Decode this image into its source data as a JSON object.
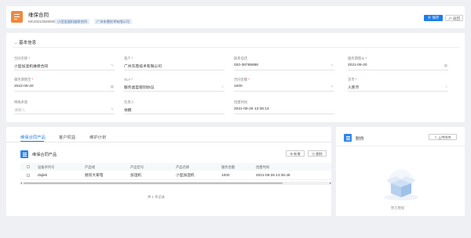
{
  "header": {
    "title": "维保合同",
    "code": "MC202109260001",
    "tags": [
      "小型加湿机维保合同",
      "广州东鼎技术有限公司"
    ],
    "save_label": "保存",
    "back_label": "返回"
  },
  "basic_info": {
    "section_title": "基本信息",
    "fields": [
      {
        "label": "合同名称",
        "required": true,
        "value": "小型加湿机维保合同",
        "icon": "edit-icon"
      },
      {
        "label": "客户",
        "required": true,
        "value": "广州东鼎技术有限公司",
        "icon": ""
      },
      {
        "label": "联系电话",
        "required": false,
        "value": "020-38788698",
        "icon": "edit-icon"
      },
      {
        "label": "服务期限从",
        "required": true,
        "value": "2021-09-20",
        "icon": "calendar-icon"
      },
      {
        "label": "服务期限至",
        "required": true,
        "value": "2022-09-20",
        "icon": "calendar-icon"
      },
      {
        "label": "SLA",
        "required": true,
        "value": "服务类型级别协议",
        "icon": "search-icon"
      },
      {
        "label": "合同金额",
        "required": true,
        "value": "1000",
        "icon": "edit-icon"
      },
      {
        "label": "货币",
        "required": true,
        "value": "人民币",
        "icon": "search-icon"
      },
      {
        "label": "特殊条款",
        "required": false,
        "value": "请输入",
        "icon": "edit-icon",
        "placeholder": true
      },
      {
        "label": "负责人",
        "required": false,
        "value": "徐鹏",
        "icon": ""
      },
      {
        "label": "创建时间",
        "required": false,
        "value": "2021-09-26 13:36:13",
        "icon": ""
      }
    ]
  },
  "products": {
    "tabs": [
      "维保合同产品",
      "客户权益",
      "维护计划"
    ],
    "list_title": "维保合同产品",
    "add_label": "新增",
    "delete_label": "删除",
    "columns": [
      "设备序列号",
      "产品线",
      "产品型号",
      "产品名称",
      "服务金额",
      "创建时间"
    ],
    "rows": [
      [
        "dsjlah",
        "厨房大家电",
        "加湿机",
        "小型加湿机",
        "1000",
        "2021-09-26 13:36:49"
      ]
    ],
    "pager": "共 1 条记录"
  },
  "attachments": {
    "title": "附件",
    "upload_label": "上传附件",
    "empty_text": "暂无数据"
  }
}
